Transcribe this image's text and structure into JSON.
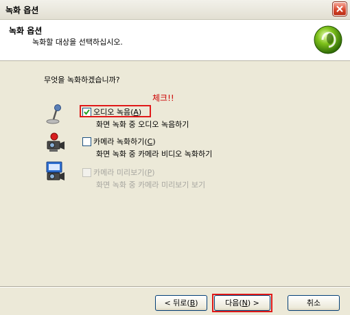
{
  "window": {
    "title": "녹화 옵션"
  },
  "header": {
    "title": "녹화 옵션",
    "subtitle": "녹화할 대상을 선택하십시오."
  },
  "question": "무엇을 녹화하겠습니까?",
  "annotation": "체크!!",
  "options": [
    {
      "label_pre": "오디오 녹음(",
      "mnemonic": "A",
      "label_post": ")",
      "description": "화면 녹화 중 오디오 녹음하기",
      "checked": true,
      "enabled": true,
      "icon": "microphone-icon"
    },
    {
      "label_pre": "카메라 녹화하기(",
      "mnemonic": "C",
      "label_post": ")",
      "description": "화면 녹화 중 카메라 비디오 녹화하기",
      "checked": false,
      "enabled": true,
      "icon": "webcam-record-icon"
    },
    {
      "label_pre": "카메라 미리보기(",
      "mnemonic": "P",
      "label_post": ")",
      "description": "화면 녹화 중 카메라 미리보기 보기",
      "checked": false,
      "enabled": false,
      "icon": "webcam-preview-icon"
    }
  ],
  "buttons": {
    "back": {
      "pre": "< 뒤로(",
      "mnemonic": "B",
      "post": ")"
    },
    "next": {
      "pre": "다음(",
      "mnemonic": "N",
      "post": ") >"
    },
    "cancel": {
      "label": "취소"
    }
  },
  "colors": {
    "highlight": "#e01818",
    "annotation": "#cc0000",
    "disabled": "#a7a6a0"
  }
}
